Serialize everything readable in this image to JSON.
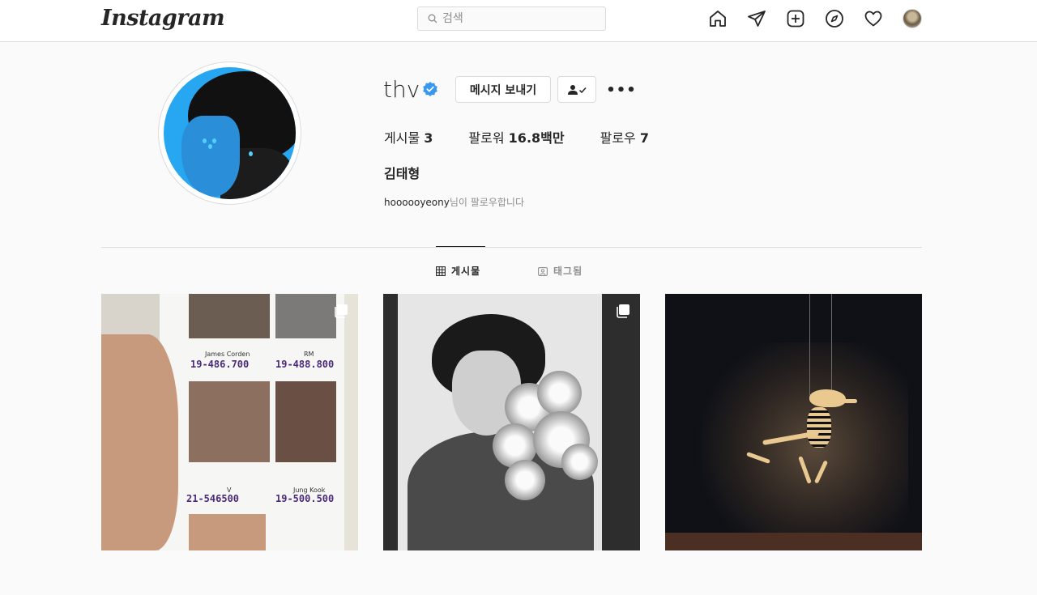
{
  "topbar": {
    "logo_text": "Instagram",
    "search_placeholder": "검색",
    "icons": [
      "home-icon",
      "direct-message-icon",
      "new-post-icon",
      "explore-icon",
      "activity-heart-icon",
      "profile-avatar"
    ]
  },
  "profile": {
    "username": "thv",
    "verified": true,
    "message_button": "메시지 보내기",
    "stats": {
      "posts_label": "게시물",
      "posts_count": "3",
      "followers_label": "팔로워",
      "followers_count": "16.8백만",
      "following_label": "팔로우",
      "following_count": "7"
    },
    "full_name": "김태형",
    "followed_by_user": "hoooooyeony",
    "followed_by_suffix": "님이 팔로우합니다"
  },
  "tabs": [
    {
      "label": "게시물",
      "active": true
    },
    {
      "label": "태그됨",
      "active": false
    }
  ],
  "posts": {
    "post1": {
      "multi": true,
      "card_names": [
        "James Corden",
        "RM",
        "V",
        "Jung Kook"
      ],
      "card_numbers": [
        "19-486.700",
        "19-488.800",
        "21-546500",
        "19-500.500"
      ]
    },
    "post2": {
      "multi": true
    },
    "post3": {
      "multi": false
    }
  },
  "colors": {
    "accent_blue": "#0095f6",
    "verified_blue": "#3897f0",
    "border": "#dbdbdb",
    "text": "#262626",
    "muted": "#8e8e8e"
  }
}
